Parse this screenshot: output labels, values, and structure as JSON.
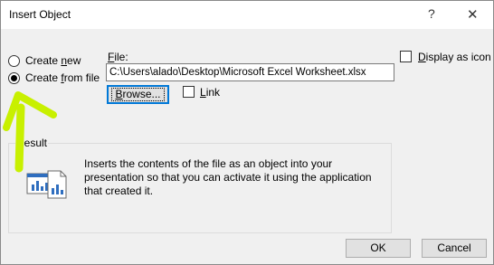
{
  "window": {
    "title": "Insert Object",
    "help_glyph": "?",
    "close_glyph": "✕"
  },
  "options": {
    "create_new": {
      "pre": "Create ",
      "key": "n",
      "post": "ew",
      "selected": false
    },
    "create_from_file": {
      "pre": "Create ",
      "key": "f",
      "post": "rom file",
      "selected": true
    }
  },
  "file": {
    "label_key": "F",
    "label_rest": "ile:",
    "path": "C:\\Users\\alado\\Desktop\\Microsoft Excel Worksheet.xlsx",
    "browse_key": "B",
    "browse_rest": "rowse...",
    "link_key": "L",
    "link_rest": "ink",
    "link_checked": false
  },
  "display_as_icon": {
    "label_pre": "",
    "label_key": "D",
    "label_rest": "isplay as icon",
    "checked": false
  },
  "result": {
    "label": "Result",
    "text": "Inserts the contents of the file as an object into your presentation so that you can activate it using the application that created it."
  },
  "buttons": {
    "ok": "OK",
    "cancel": "Cancel"
  },
  "icons": {
    "result": "embedded-object-icon",
    "annotation": "green-arrow-annotation"
  },
  "colors": {
    "focus_blue": "#0078d7",
    "annotation_green": "#c8f000"
  }
}
